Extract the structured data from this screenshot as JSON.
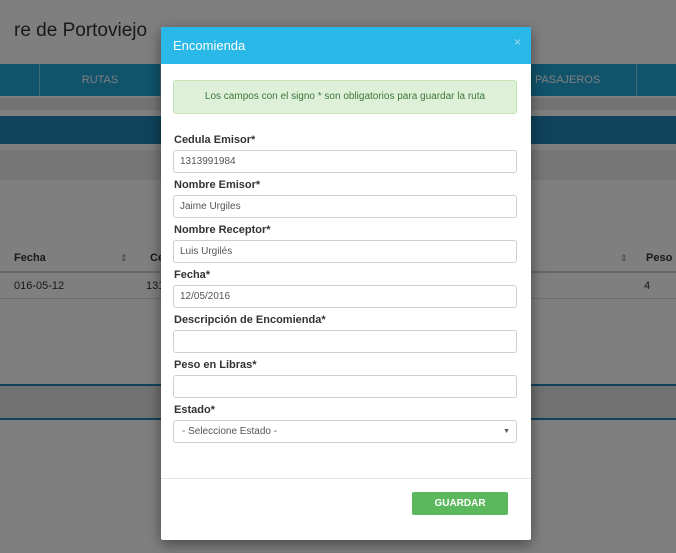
{
  "background": {
    "page_title": "re de Portoviejo",
    "nav": {
      "rutas": "RUTAS",
      "pasajeros": "PASAJEROS"
    },
    "table": {
      "headers": {
        "fecha": "Fecha",
        "cedula": "Ce",
        "peso": "Peso"
      },
      "sort_icon": "⇕",
      "rows": [
        {
          "fecha": "016-05-12",
          "cedula": "131",
          "peso": "4"
        }
      ]
    }
  },
  "modal": {
    "title": "Encomienda",
    "close_icon": "×",
    "alert": "Los campos con el signo * son obligatorios para guardar la ruta",
    "fields": {
      "cedula_emisor": {
        "label": "Cedula Emisor*",
        "value": "1313991984"
      },
      "nombre_emisor": {
        "label": "Nombre Emisor*",
        "value": "Jaime Urgiles"
      },
      "nombre_receptor": {
        "label": "Nombre Receptor*",
        "value": "Luis Urgilés"
      },
      "fecha": {
        "label": "Fecha*",
        "value": "12/05/2016"
      },
      "descripcion": {
        "label": "Descripción de Encomienda*",
        "value": ""
      },
      "peso": {
        "label": "Peso en Libras*",
        "value": ""
      },
      "estado": {
        "label": "Estado*",
        "selected": "- Seleccione Estado -",
        "caret": "▼"
      }
    },
    "save_label": "GUARDAR"
  },
  "colors": {
    "header": "#2ab8e8",
    "nav": "#20a7d6",
    "save_button": "#5cb85c",
    "alert_bg": "#dff0d8"
  }
}
